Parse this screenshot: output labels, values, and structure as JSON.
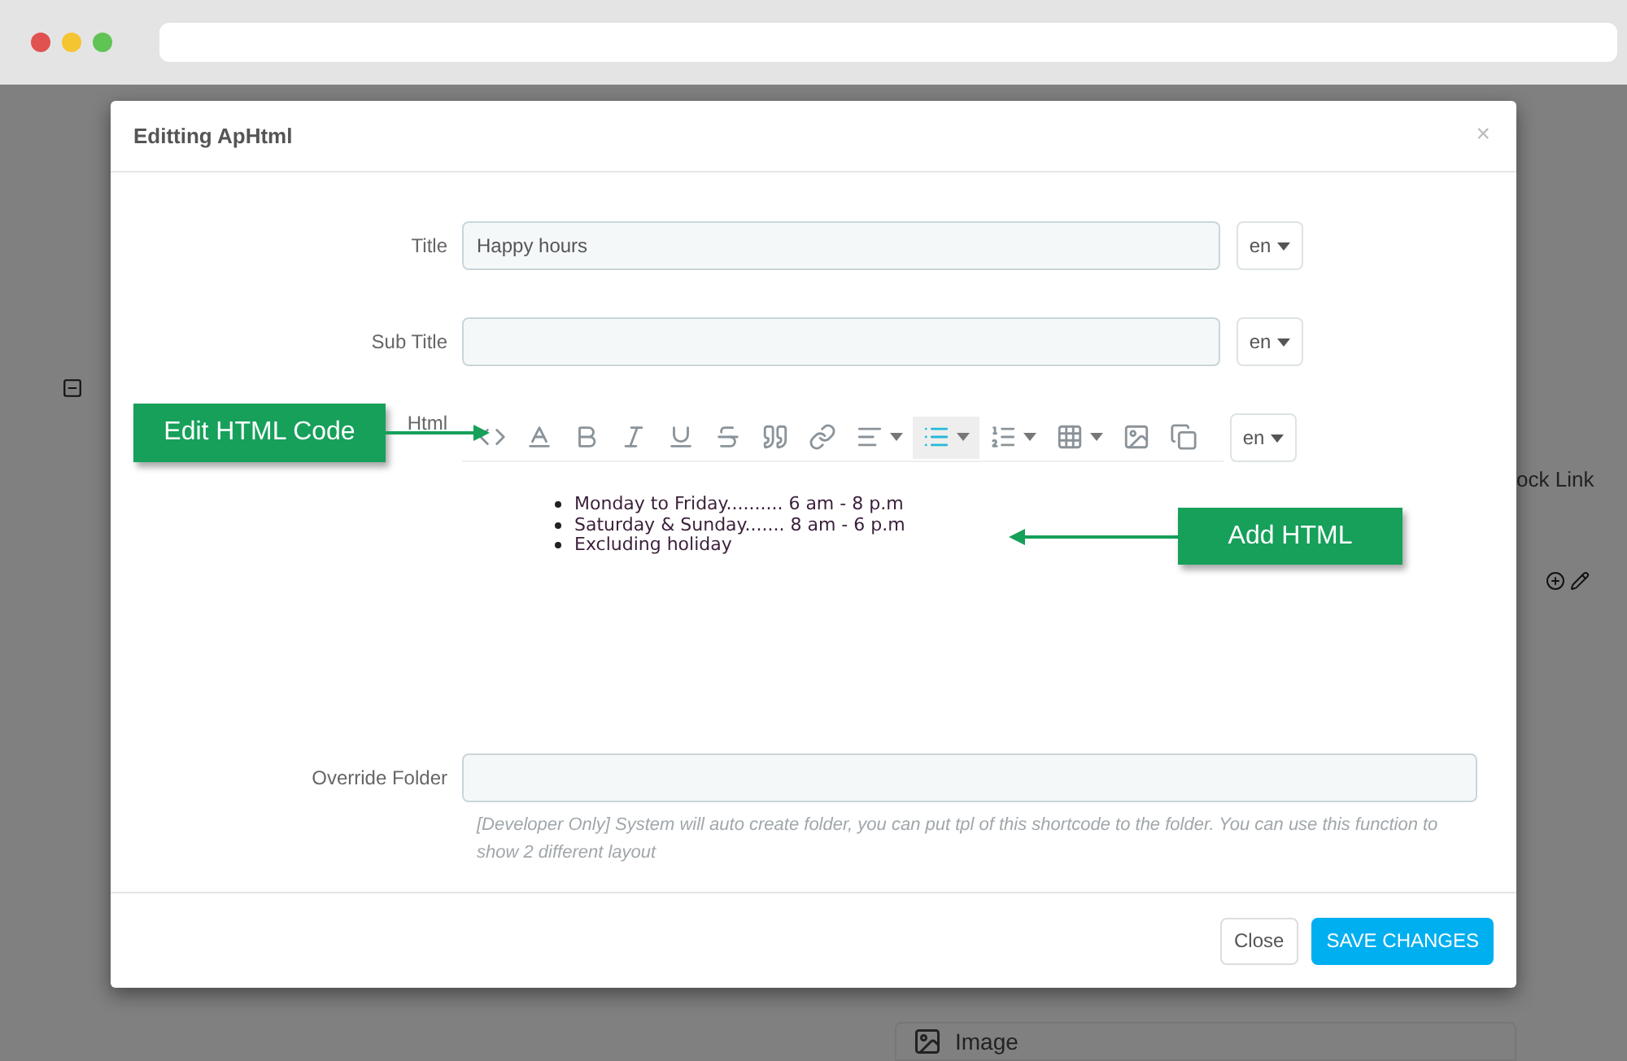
{
  "background": {
    "side_link": "ock Link",
    "image_label": "Image"
  },
  "modal": {
    "title": "Editting ApHtml",
    "close_symbol": "×",
    "fields": [
      {
        "kind": "text",
        "label": "Title",
        "value": "Happy hours",
        "language": "en"
      },
      {
        "kind": "text",
        "label": "Sub Title",
        "language": "en"
      },
      {
        "kind": "editor",
        "label": "Html",
        "language": "en",
        "toolbar": [
          {
            "selected": false
          },
          {
            "selected": false
          },
          {
            "selected": false
          },
          {
            "selected": false
          },
          {
            "selected": false
          },
          {
            "selected": false
          },
          {
            "selected": false
          },
          {
            "selected": false
          },
          {
            "selected": false
          },
          {
            "selected": true
          },
          {
            "selected": false
          },
          {
            "selected": false
          },
          {
            "selected": false
          },
          {
            "selected": false
          }
        ],
        "content": [
          "Monday to Friday.......... 6 am - 8 p.m",
          "Saturday & Sunday....... 8 am - 6 p.m",
          "Excluding holiday"
        ]
      },
      {
        "kind": "folder",
        "label": "Override Folder",
        "help": "[Developer Only] System will auto create folder, you can put tpl of this shortcode to the folder. You can use this function to show 2 different layout"
      }
    ],
    "buttons": [
      {
        "kind": "secondary",
        "label": "Close"
      },
      {
        "kind": "primary",
        "label": "SAVE CHANGES"
      }
    ]
  },
  "callouts": [
    {
      "kind": "left",
      "label": "Edit HTML Code"
    },
    {
      "kind": "right",
      "label": "Add HTML"
    }
  ]
}
